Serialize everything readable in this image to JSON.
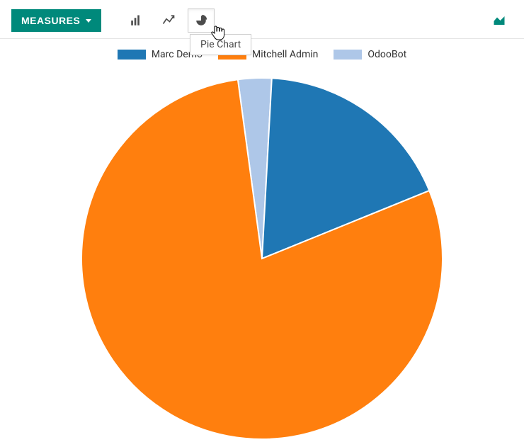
{
  "toolbar": {
    "measures_label": "MEASURES",
    "tooltip": "Pie Chart"
  },
  "legend": [
    {
      "label": "Marc Demo",
      "color": "#1f77b4"
    },
    {
      "label": "Mitchell Admin",
      "color": "#ff7f0e"
    },
    {
      "label": "OdooBot",
      "color": "#aec7e8"
    }
  ],
  "chart_data": {
    "type": "pie",
    "title": "",
    "series": [
      {
        "name": "Marc Demo",
        "value": 18,
        "color": "#1f77b4"
      },
      {
        "name": "Mitchell Admin",
        "value": 79,
        "color": "#ff7f0e"
      },
      {
        "name": "OdooBot",
        "value": 3,
        "color": "#aec7e8"
      }
    ]
  }
}
